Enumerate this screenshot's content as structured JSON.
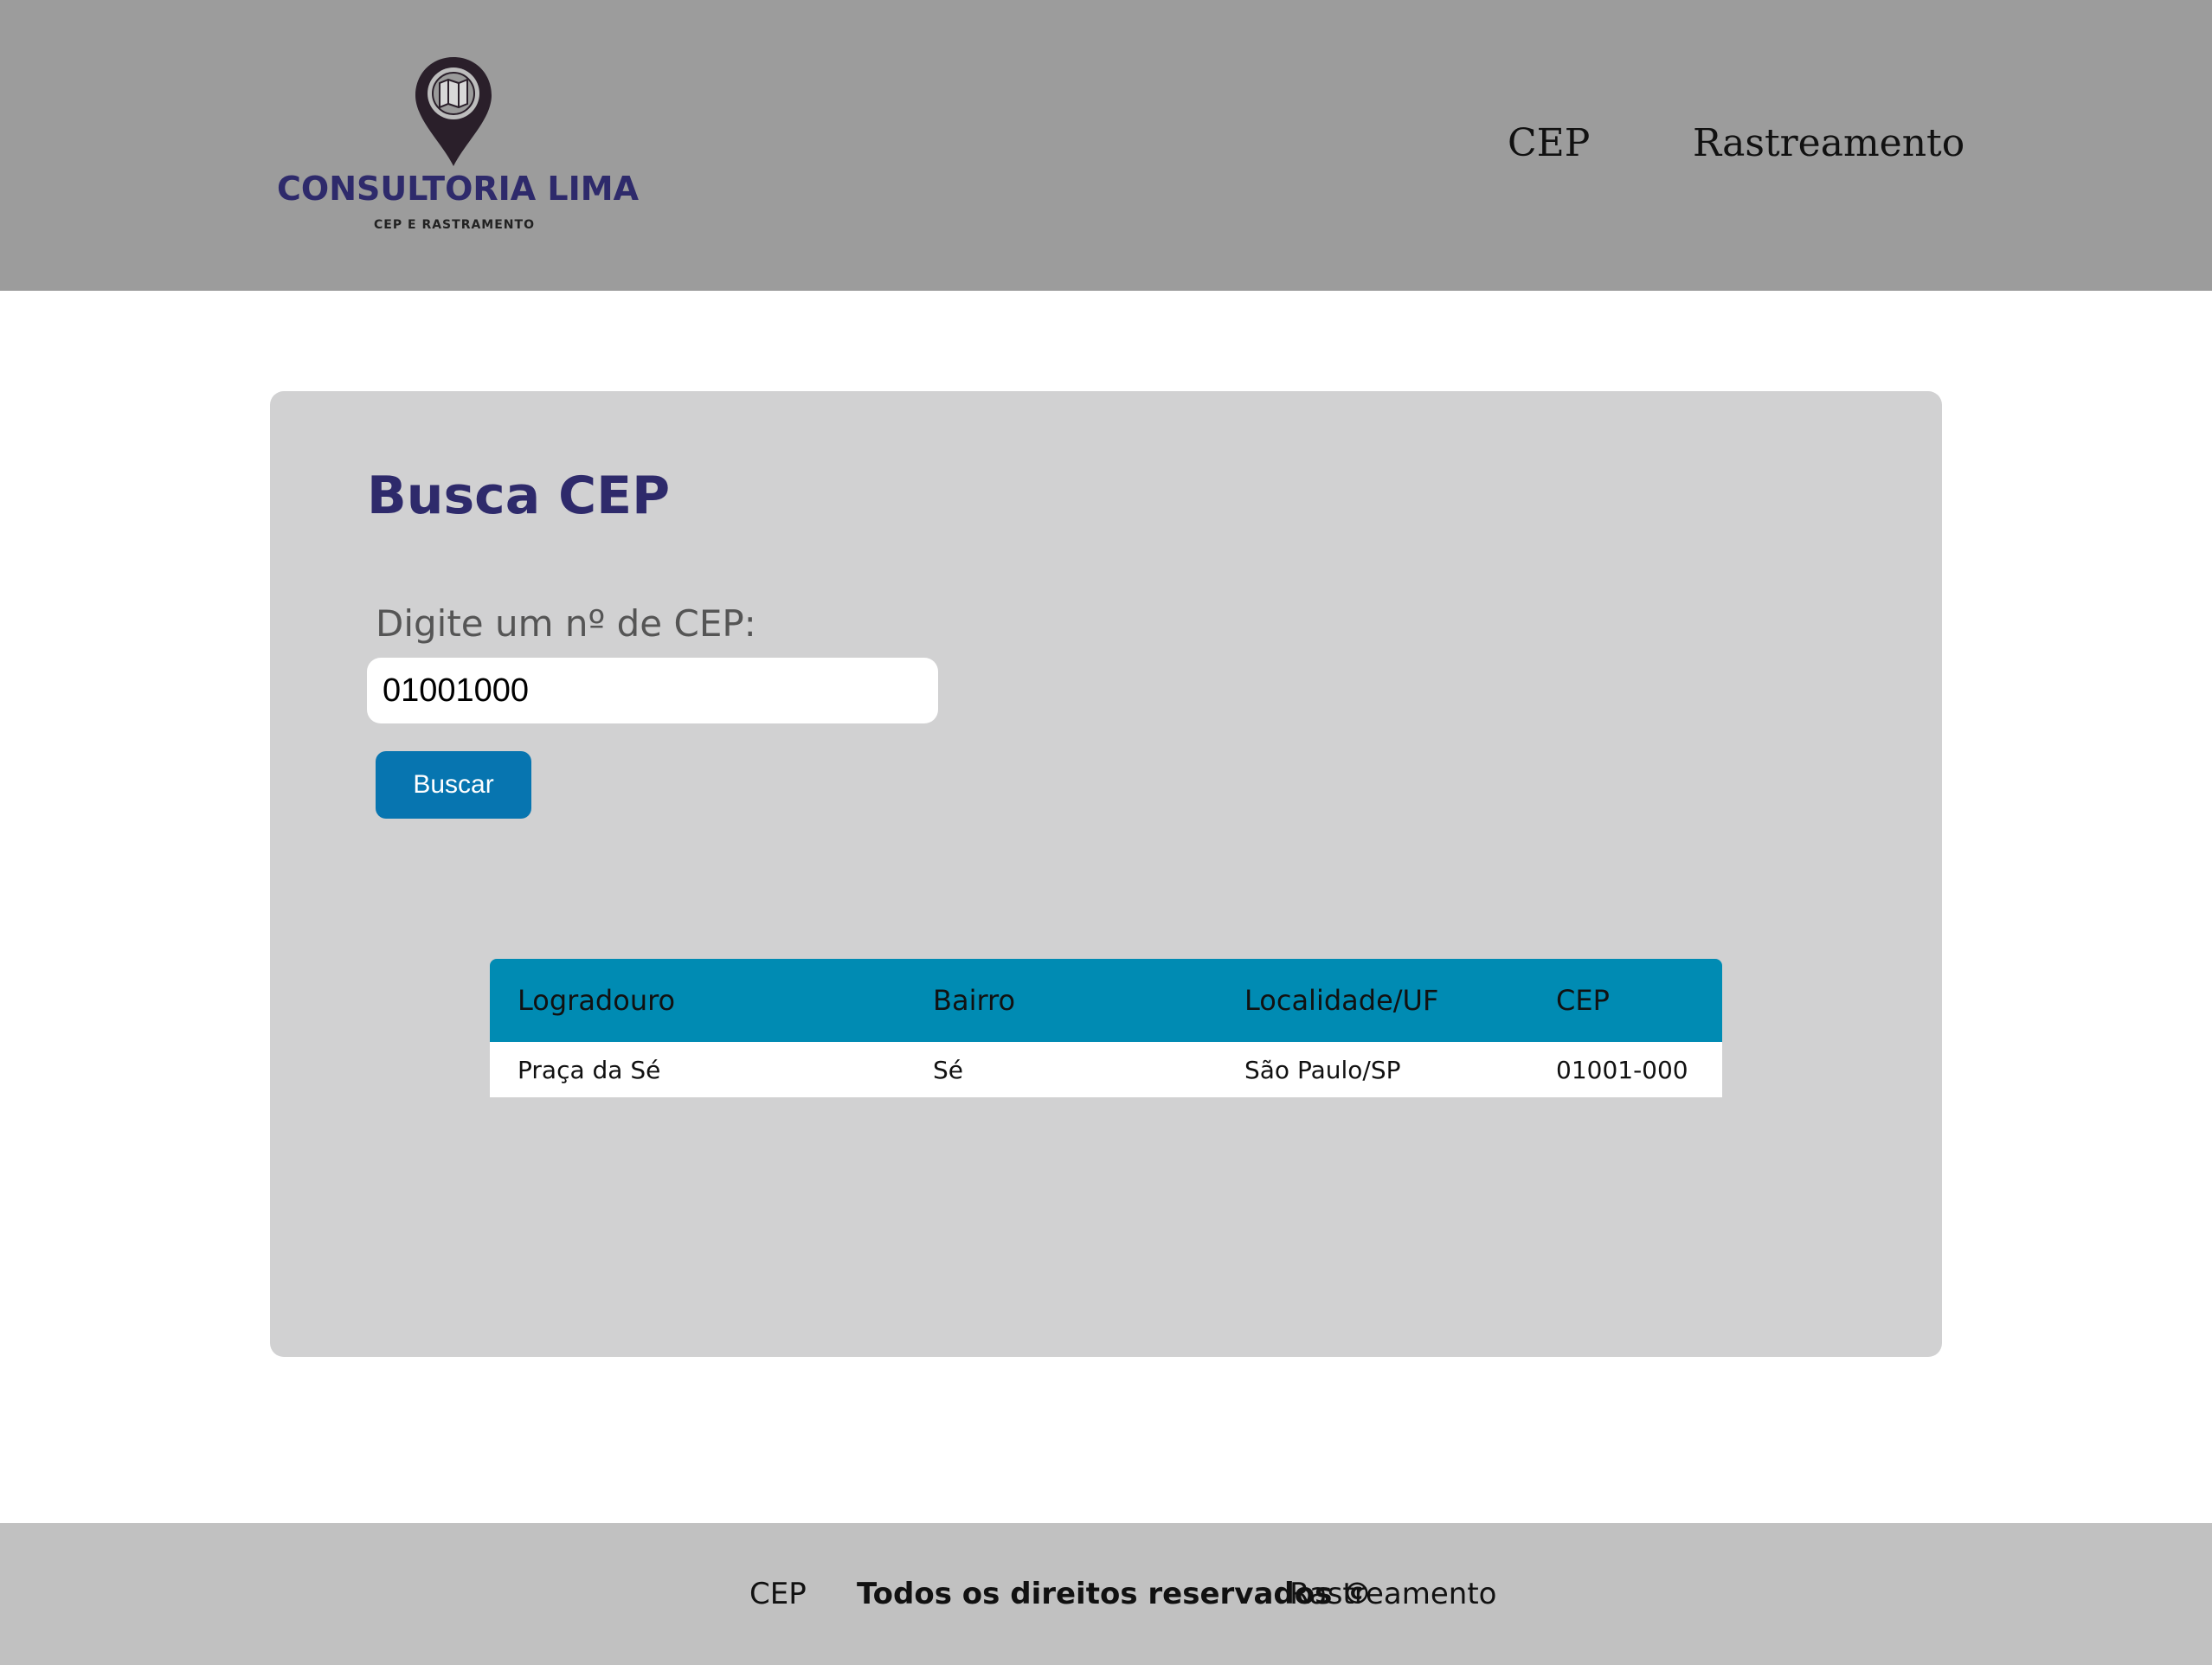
{
  "header": {
    "logo": {
      "title": "CONSULTORIA LIMA",
      "subtitle": "CEP E RASTRAMENTO",
      "pin_color": "#2a1f2a"
    },
    "nav": [
      {
        "label": "CEP"
      },
      {
        "label": "Rastreamento"
      }
    ]
  },
  "main": {
    "title": "Busca CEP",
    "field_label": "Digite um nº de CEP:",
    "cep_input_value": "01001000",
    "search_button_label": "Buscar",
    "table": {
      "headers": [
        "Logradouro",
        "Bairro",
        "Localidade/UF",
        "CEP"
      ],
      "rows": [
        [
          "Praça da Sé",
          "Sé",
          "São Paulo/SP",
          "01001-000"
        ]
      ]
    }
  },
  "footer": {
    "cep_link": "CEP",
    "rights": "Todos os direitos reservados ©",
    "rastreamento_link": "Rastreamento"
  },
  "colors": {
    "header_bg": "#9c9c9c",
    "brand": "#2e2a6b",
    "card_bg": "#d1d1d2",
    "button": "#0775b0",
    "table_header": "#008bb3",
    "footer_bg": "#c1c1c1"
  }
}
